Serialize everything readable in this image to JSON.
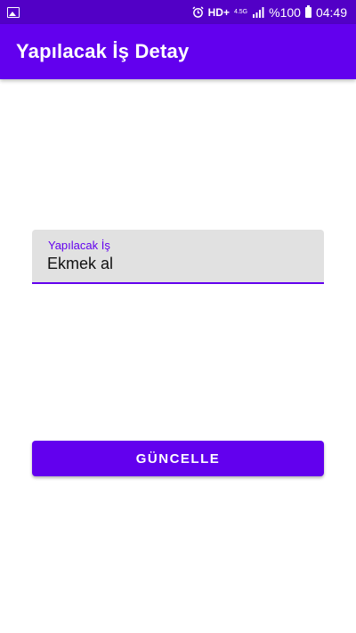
{
  "status_bar": {
    "left_icon": "image-icon",
    "alarm_icon": "alarm-icon",
    "hd": "HD+",
    "network": "4.5G",
    "signal_icon": "signal-icon",
    "battery_percent": "%100",
    "battery_icon": "battery-icon",
    "time": "04:49"
  },
  "app_bar": {
    "title": "Yapılacak İş Detay"
  },
  "task_field": {
    "label": "Yapılacak İş",
    "value": "Ekmek al"
  },
  "update_button": {
    "label": "GÜNCELLE"
  },
  "colors": {
    "primary": "#6200ee",
    "status_bar": "#5200c6",
    "field_bg": "#e1e1e1"
  }
}
